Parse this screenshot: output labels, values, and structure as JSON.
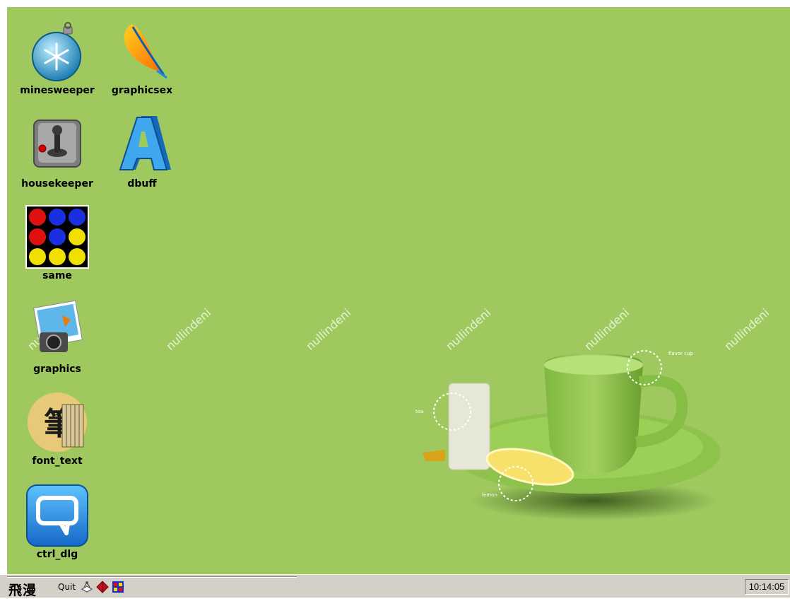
{
  "desktop": {
    "background_color": "#9fc95f",
    "watermark_text": "nullindeni",
    "teacup_labels": [
      "tea",
      "flavor cup",
      "lemon"
    ],
    "icons": [
      {
        "label": "minesweeper",
        "icon": "snowflake-ornament-icon"
      },
      {
        "label": "graphicsex",
        "icon": "feather-icon"
      },
      {
        "label": "housekeeper",
        "icon": "joystick-icon"
      },
      {
        "label": "dbuff",
        "icon": "letter-a-icon"
      },
      {
        "label": "same",
        "icon": "colored-balls-icon"
      },
      {
        "label": "graphics",
        "icon": "camera-photo-icon"
      },
      {
        "label": "font_text",
        "icon": "calligraphy-icon"
      },
      {
        "label": "ctrl_dlg",
        "icon": "speech-bubble-icon"
      }
    ]
  },
  "taskbar": {
    "start_logo": "飛漫",
    "quit_label": "Quit",
    "tray_icons": [
      "network-icon",
      "diamond-icon",
      "grid-app-icon"
    ],
    "clock": "10:14:05"
  }
}
